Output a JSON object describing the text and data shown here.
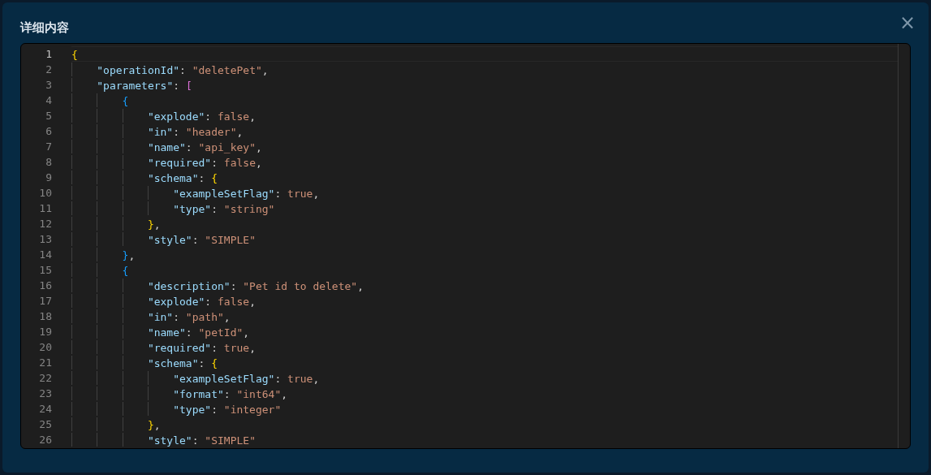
{
  "dialog": {
    "title": "详细内容",
    "close": "×"
  },
  "editor": {
    "lines": [
      {
        "number": "1",
        "text": "{",
        "selected": true
      },
      {
        "number": "2",
        "text": "    \"operationId\": \"deletePet\",",
        "selected": false
      },
      {
        "number": "3",
        "text": "    \"parameters\": [",
        "selected": false
      },
      {
        "number": "4",
        "text": "        {",
        "selected": false
      },
      {
        "number": "5",
        "text": "            \"explode\": false,",
        "selected": false
      },
      {
        "number": "6",
        "text": "            \"in\": \"header\",",
        "selected": false
      },
      {
        "number": "7",
        "text": "            \"name\": \"api_key\",",
        "selected": false
      },
      {
        "number": "8",
        "text": "            \"required\": false,",
        "selected": false
      },
      {
        "number": "9",
        "text": "            \"schema\": {",
        "selected": false
      },
      {
        "number": "10",
        "text": "                \"exampleSetFlag\": true,",
        "selected": false
      },
      {
        "number": "11",
        "text": "                \"type\": \"string\"",
        "selected": false
      },
      {
        "number": "12",
        "text": "            },",
        "selected": false
      },
      {
        "number": "13",
        "text": "            \"style\": \"SIMPLE\"",
        "selected": false
      },
      {
        "number": "14",
        "text": "        },",
        "selected": false
      },
      {
        "number": "15",
        "text": "        {",
        "selected": false
      },
      {
        "number": "16",
        "text": "            \"description\": \"Pet id to delete\",",
        "selected": false
      },
      {
        "number": "17",
        "text": "            \"explode\": false,",
        "selected": false
      },
      {
        "number": "18",
        "text": "            \"in\": \"path\",",
        "selected": false
      },
      {
        "number": "19",
        "text": "            \"name\": \"petId\",",
        "selected": false
      },
      {
        "number": "20",
        "text": "            \"required\": true,",
        "selected": false
      },
      {
        "number": "21",
        "text": "            \"schema\": {",
        "selected": false
      },
      {
        "number": "22",
        "text": "                \"exampleSetFlag\": true,",
        "selected": false
      },
      {
        "number": "23",
        "text": "                \"format\": \"int64\",",
        "selected": false
      },
      {
        "number": "24",
        "text": "                \"type\": \"integer\"",
        "selected": false
      },
      {
        "number": "25",
        "text": "            },",
        "selected": false
      },
      {
        "number": "26",
        "text": "            \"style\": \"SIMPLE\"",
        "selected": false
      }
    ]
  }
}
